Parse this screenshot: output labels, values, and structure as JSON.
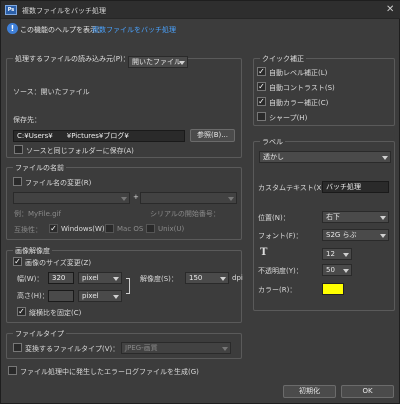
{
  "window": {
    "title": "複数ファイルをバッチ処理",
    "app_icon": "Ps",
    "close": "✕"
  },
  "help": {
    "text": "この機能のヘルプを表示：",
    "link": "複数ファイルをバッチ処理"
  },
  "source_group": {
    "legend": "処理するファイルの読み込み元(P)：",
    "select_value": "開いたファイル",
    "source_label": "ソース：開いたファイル",
    "dest_label": "保存先：",
    "dest_path": "C:¥Users¥　　¥Pictures¥ブログ¥",
    "browse_button": "参照(B)...",
    "same_folder_label": "ソースと同じフォルダーに保存(A)",
    "same_folder_checked": false
  },
  "naming_group": {
    "legend": "ファイルの名前",
    "rename_label": "ファイル名の変更(R)",
    "rename_checked": false,
    "plus": "+",
    "example_label": "例：MyFile.gif",
    "serial_label": "シリアルの開始番号：",
    "compat_label": "互換性：",
    "windows_label": "Windows(W)",
    "macos_label": "Mac OS",
    "unix_label": "Unix(U)",
    "windows_checked": true,
    "macos_checked": false,
    "unix_checked": false
  },
  "size_group": {
    "legend": "画像解像度",
    "resize_label": "画像のサイズ変更(Z)",
    "resize_checked": true,
    "width_label": "幅(W)：",
    "width_value": "320",
    "width_unit": "pixel",
    "height_label": "高さ(H)：",
    "height_value": "",
    "height_unit": "pixel",
    "resolution_label": "解像度(S)：",
    "resolution_value": "150",
    "resolution_unit": "dpi",
    "constrain_label": "縦横比を固定(C)",
    "constrain_checked": true
  },
  "type_group": {
    "legend": "ファイルタイプ",
    "convert_label": "変換するファイルタイプ(V)：",
    "convert_checked": false,
    "type_value": "JPEG-画質",
    "log_label": "ファイル処理中に発生したエラーログファイルを生成(G)",
    "log_checked": false
  },
  "quick_fix": {
    "legend": "クイック補正",
    "items": [
      {
        "label": "自動レベル補正(L)",
        "checked": true
      },
      {
        "label": "自動コントラスト(S)",
        "checked": true
      },
      {
        "label": "自動カラー補正(C)",
        "checked": true
      },
      {
        "label": "シャープ(H)",
        "checked": false
      }
    ]
  },
  "label_group": {
    "legend": "ラベル",
    "type_value": "透かし",
    "custom_text_label": "カスタムテキスト(X)：",
    "custom_text_value": "バッチ処理",
    "position_label": "位置(N)：",
    "position_value": "右下",
    "font_label": "フォント(F)：",
    "font_value": "S2G らぶ",
    "size_icon": "T",
    "size_value": "12",
    "opacity_label": "不透明度(Y)：",
    "opacity_value": "50",
    "color_label": "カラー(R)：",
    "color_value": "#ffff00"
  },
  "buttons": {
    "reset": "初期化",
    "ok": "OK"
  }
}
